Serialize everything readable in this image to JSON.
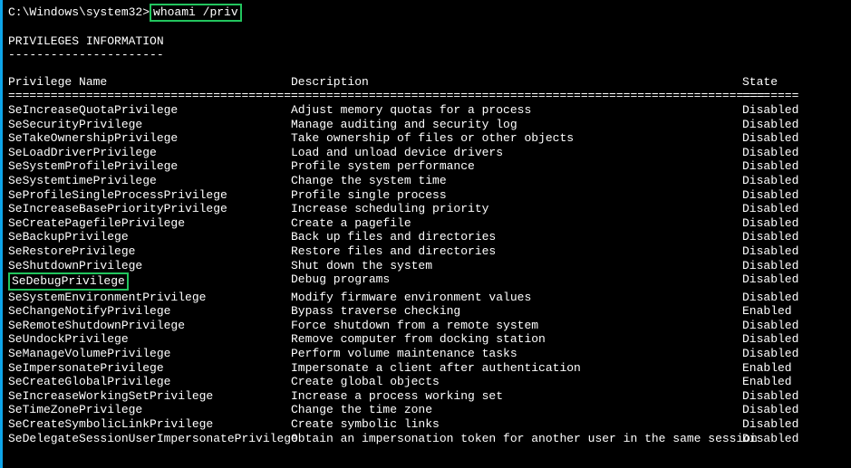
{
  "prompt": {
    "path": "C:\\Windows\\system32>",
    "command": "whoami /priv"
  },
  "section": {
    "title": "PRIVILEGES INFORMATION",
    "underline": "----------------------"
  },
  "table": {
    "headers": {
      "name": "Privilege Name",
      "desc": "Description",
      "state": "State"
    },
    "divider": {
      "name": "=========================================",
      "desc": "===================================================================",
      "state": "========"
    },
    "rows": [
      {
        "name": "SeIncreaseQuotaPrivilege",
        "desc": "Adjust memory quotas for a process",
        "state": "Disabled",
        "highlight": false
      },
      {
        "name": "SeSecurityPrivilege",
        "desc": "Manage auditing and security log",
        "state": "Disabled",
        "highlight": false
      },
      {
        "name": "SeTakeOwnershipPrivilege",
        "desc": "Take ownership of files or other objects",
        "state": "Disabled",
        "highlight": false
      },
      {
        "name": "SeLoadDriverPrivilege",
        "desc": "Load and unload device drivers",
        "state": "Disabled",
        "highlight": false
      },
      {
        "name": "SeSystemProfilePrivilege",
        "desc": "Profile system performance",
        "state": "Disabled",
        "highlight": false
      },
      {
        "name": "SeSystemtimePrivilege",
        "desc": "Change the system time",
        "state": "Disabled",
        "highlight": false
      },
      {
        "name": "SeProfileSingleProcessPrivilege",
        "desc": "Profile single process",
        "state": "Disabled",
        "highlight": false
      },
      {
        "name": "SeIncreaseBasePriorityPrivilege",
        "desc": "Increase scheduling priority",
        "state": "Disabled",
        "highlight": false
      },
      {
        "name": "SeCreatePagefilePrivilege",
        "desc": "Create a pagefile",
        "state": "Disabled",
        "highlight": false
      },
      {
        "name": "SeBackupPrivilege",
        "desc": "Back up files and directories",
        "state": "Disabled",
        "highlight": false
      },
      {
        "name": "SeRestorePrivilege",
        "desc": "Restore files and directories",
        "state": "Disabled",
        "highlight": false
      },
      {
        "name": "SeShutdownPrivilege",
        "desc": "Shut down the system",
        "state": "Disabled",
        "highlight": false
      },
      {
        "name": "SeDebugPrivilege",
        "desc": "Debug programs",
        "state": "Disabled",
        "highlight": true
      },
      {
        "name": "SeSystemEnvironmentPrivilege",
        "desc": "Modify firmware environment values",
        "state": "Disabled",
        "highlight": false
      },
      {
        "name": "SeChangeNotifyPrivilege",
        "desc": "Bypass traverse checking",
        "state": "Enabled",
        "highlight": false
      },
      {
        "name": "SeRemoteShutdownPrivilege",
        "desc": "Force shutdown from a remote system",
        "state": "Disabled",
        "highlight": false
      },
      {
        "name": "SeUndockPrivilege",
        "desc": "Remove computer from docking station",
        "state": "Disabled",
        "highlight": false
      },
      {
        "name": "SeManageVolumePrivilege",
        "desc": "Perform volume maintenance tasks",
        "state": "Disabled",
        "highlight": false
      },
      {
        "name": "SeImpersonatePrivilege",
        "desc": "Impersonate a client after authentication",
        "state": "Enabled",
        "highlight": false
      },
      {
        "name": "SeCreateGlobalPrivilege",
        "desc": "Create global objects",
        "state": "Enabled",
        "highlight": false
      },
      {
        "name": "SeIncreaseWorkingSetPrivilege",
        "desc": "Increase a process working set",
        "state": "Disabled",
        "highlight": false
      },
      {
        "name": "SeTimeZonePrivilege",
        "desc": "Change the time zone",
        "state": "Disabled",
        "highlight": false
      },
      {
        "name": "SeCreateSymbolicLinkPrivilege",
        "desc": "Create symbolic links",
        "state": "Disabled",
        "highlight": false
      },
      {
        "name": "SeDelegateSessionUserImpersonatePrivilege",
        "desc": "Obtain an impersonation token for another user in the same session",
        "state": "Disabled",
        "highlight": false
      }
    ]
  }
}
